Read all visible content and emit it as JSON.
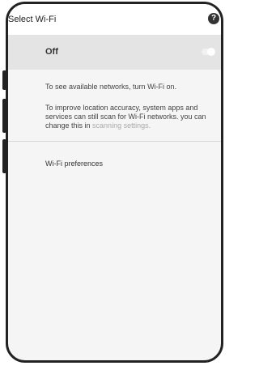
{
  "header": {
    "title": "Select Wi-Fi",
    "help_icon": "help-icon",
    "help_glyph": "?"
  },
  "wifi": {
    "toggle_label": "Off",
    "enabled": false
  },
  "info": {
    "line1": "To see available networks, turn Wi-Fi on.",
    "line2_text": "To improve location accuracy, system apps and services can still scan for Wi-Fi networks. you can change this in ",
    "line2_link": "scanning settings."
  },
  "menu": {
    "preferences": "Wi-Fi preferences"
  },
  "colors": {
    "frame": "#222222",
    "toggle_row_bg": "#e4e4e4",
    "screen_bg": "#f5f5f5",
    "link": "#aaaaaa"
  }
}
